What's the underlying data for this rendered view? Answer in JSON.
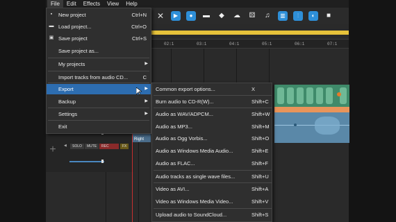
{
  "menubar": {
    "items": [
      {
        "label": "File"
      },
      {
        "label": "Edit"
      },
      {
        "label": "Effects"
      },
      {
        "label": "View"
      },
      {
        "label": "Help"
      }
    ]
  },
  "toolbar": {
    "icons": [
      "close-icon",
      "play-icon",
      "record-icon",
      "folder-icon",
      "cart-icon",
      "cloud-download-icon",
      "dice-icon",
      "music-note-icon",
      "keyboard-icon",
      "mixer-icon",
      "effects-icon",
      "stop-icon"
    ]
  },
  "ruler": {
    "ticks": [
      "02:1",
      "03:1",
      "04:1",
      "05:1",
      "06:1",
      "07:1"
    ]
  },
  "track_header": {
    "solo": "SOLO",
    "mute": "MUTE",
    "rec": "REC",
    "fx": "FX",
    "clip_label": "Right"
  },
  "file_menu": {
    "items": [
      {
        "label": "New project",
        "shortcut": "Ctrl+N"
      },
      {
        "label": "Load project...",
        "shortcut": "Ctrl+O"
      },
      {
        "label": "Save project",
        "shortcut": "Ctrl+S"
      },
      {
        "label": "Save project as...",
        "shortcut": ""
      },
      {
        "label": "My projects",
        "shortcut": ""
      },
      {
        "label": "Import tracks from audio CD...",
        "shortcut": "C"
      },
      {
        "label": "Export",
        "shortcut": ""
      },
      {
        "label": "Backup",
        "shortcut": ""
      },
      {
        "label": "Settings",
        "shortcut": ""
      },
      {
        "label": "Exit",
        "shortcut": ""
      }
    ]
  },
  "export_menu": {
    "items": [
      {
        "label": "Common export options...",
        "shortcut": "X"
      },
      {
        "label": "Burn audio to CD-R(W)...",
        "shortcut": "Shift+C"
      },
      {
        "label": "Audio as WAV/ADPCM...",
        "shortcut": "Shift+W"
      },
      {
        "label": "Audio as MP3...",
        "shortcut": "Shift+M"
      },
      {
        "label": "Audio as Ogg Vorbis...",
        "shortcut": "Shift+O"
      },
      {
        "label": "Audio as Windows Media Audio...",
        "shortcut": "Shift+E"
      },
      {
        "label": "Audio as FLAC...",
        "shortcut": "Shift+F"
      },
      {
        "label": "Audio tracks as single wave files...",
        "shortcut": "Shift+U"
      },
      {
        "label": "Video as AVI...",
        "shortcut": "Shift+A"
      },
      {
        "label": "Video as Windows Media Video...",
        "shortcut": "Shift+V"
      },
      {
        "label": "Upload audio to SoundCloud...",
        "shortcut": "Shift+S"
      }
    ]
  },
  "colors": {
    "highlight": "#2d6db0",
    "accent_yellow": "#e6c23a",
    "track_green": "#3f8a6a",
    "track_blue": "#5a88a8",
    "toolbar_blue": "#2e8fd8"
  }
}
